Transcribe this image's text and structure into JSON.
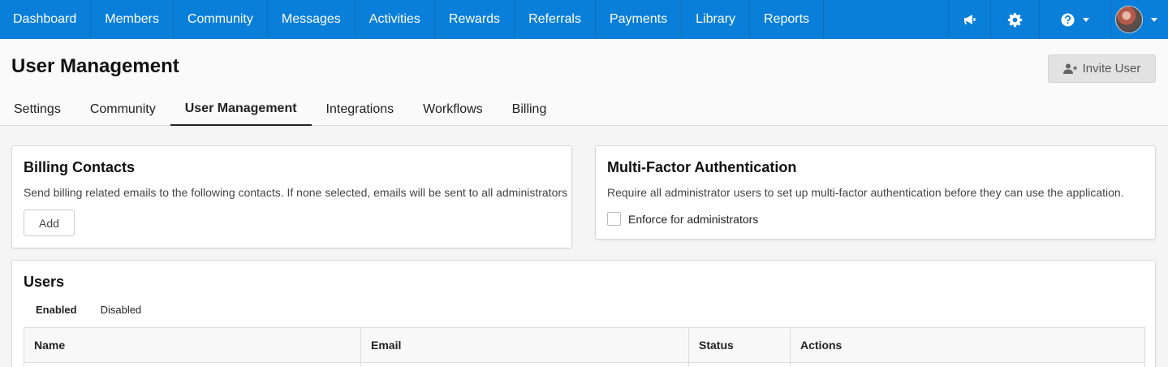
{
  "nav": {
    "items": [
      "Dashboard",
      "Members",
      "Community",
      "Messages",
      "Activities",
      "Rewards",
      "Referrals",
      "Payments",
      "Library",
      "Reports"
    ],
    "icons": [
      "megaphone-icon",
      "gear-icon",
      "help-icon",
      "avatar"
    ],
    "color": "#0a7fd9"
  },
  "header": {
    "title": "User Management",
    "invite_label": "Invite User",
    "tabs": [
      "Settings",
      "Community",
      "User Management",
      "Integrations",
      "Workflows",
      "Billing"
    ],
    "active_tab": "User Management"
  },
  "billing": {
    "title": "Billing Contacts",
    "description": "Send billing related emails to the following contacts. If none selected, emails will be sent to all administrators",
    "add_label": "Add"
  },
  "mfa": {
    "title": "Multi-Factor Authentication",
    "description": "Require all administrator users to set up multi-factor authentication before they can use the application.",
    "checkbox_label": "Enforce for administrators",
    "checked": false
  },
  "users": {
    "title": "Users",
    "subtabs": [
      "Enabled",
      "Disabled"
    ],
    "active_subtab": "Enabled",
    "columns": [
      "Name",
      "Email",
      "Status",
      "Actions"
    ]
  }
}
